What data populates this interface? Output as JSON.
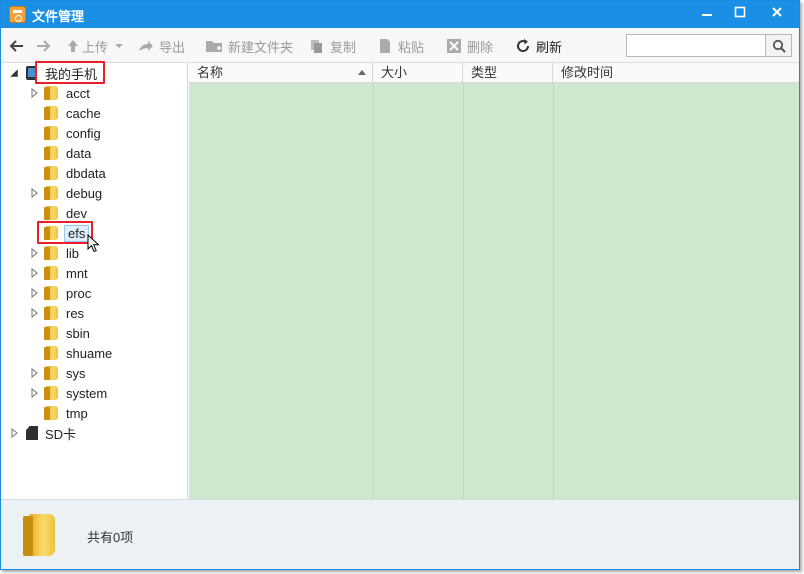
{
  "window": {
    "title": "文件管理",
    "accent": "#1a8fe3"
  },
  "toolbar": {
    "back_icon": "arrow-left-icon",
    "forward_icon": "arrow-right-icon",
    "upload_label": "上传",
    "export_label": "导出",
    "new_folder_label": "新建文件夹",
    "copy_label": "复制",
    "paste_label": "粘贴",
    "delete_label": "删除",
    "refresh_label": "刷新",
    "search_placeholder": ""
  },
  "tree": {
    "root_label": "我的手机",
    "items": [
      {
        "label": "acct",
        "expandable": true
      },
      {
        "label": "cache",
        "expandable": false
      },
      {
        "label": "config",
        "expandable": false
      },
      {
        "label": "data",
        "expandable": false
      },
      {
        "label": "dbdata",
        "expandable": false
      },
      {
        "label": "debug",
        "expandable": true
      },
      {
        "label": "dev",
        "expandable": false
      },
      {
        "label": "efs",
        "expandable": false,
        "selected": true
      },
      {
        "label": "lib",
        "expandable": true
      },
      {
        "label": "mnt",
        "expandable": true
      },
      {
        "label": "proc",
        "expandable": true
      },
      {
        "label": "res",
        "expandable": true
      },
      {
        "label": "sbin",
        "expandable": false
      },
      {
        "label": "shuame",
        "expandable": false
      },
      {
        "label": "sys",
        "expandable": true
      },
      {
        "label": "system",
        "expandable": true
      },
      {
        "label": "tmp",
        "expandable": false
      }
    ],
    "sd_label": "SD卡"
  },
  "list": {
    "columns": [
      "名称",
      "大小",
      "类型",
      "修改时间"
    ],
    "background": "#cde8cf"
  },
  "status": {
    "text": "共有0项"
  }
}
